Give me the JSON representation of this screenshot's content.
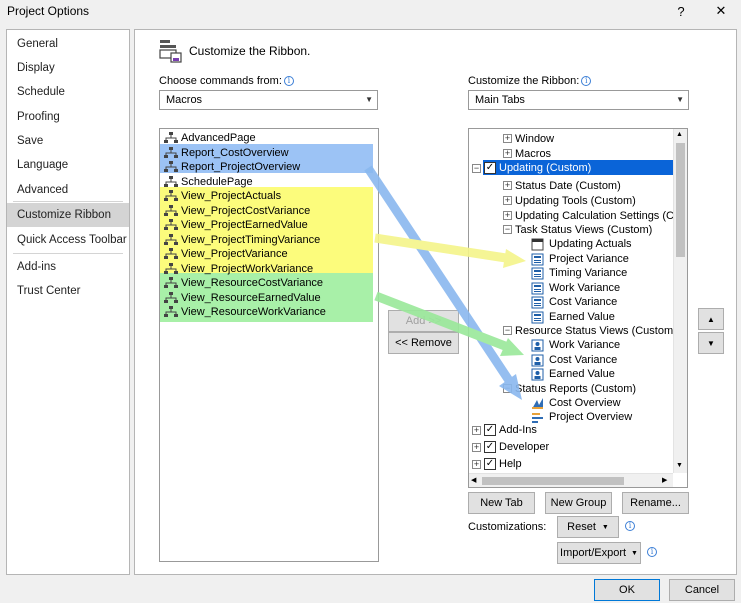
{
  "window": {
    "title": "Project Options",
    "help_label": "?",
    "close_label": "✕"
  },
  "nav": {
    "items": [
      "General",
      "Display",
      "Schedule",
      "Proofing",
      "Save",
      "Language",
      "Advanced",
      "Customize Ribbon",
      "Quick Access Toolbar",
      "Add-ins",
      "Trust Center"
    ],
    "selected": "Customize Ribbon"
  },
  "header": {
    "title": "Customize the Ribbon."
  },
  "left": {
    "label": "Choose commands from:",
    "combo_value": "Macros",
    "commands": [
      "AdvancedPage",
      "Report_CostOverview",
      "Report_ProjectOverview",
      "SchedulePage",
      "View_ProjectActuals",
      "View_ProjectCostVariance",
      "View_ProjectEarnedValue",
      "View_ProjectTimingVariance",
      "View_ProjectVariance",
      "View_ProjectWorkVariance",
      "View_ResourceCostVariance",
      "View_ResourceEarnedValue",
      "View_ResourceWorkVariance"
    ]
  },
  "middle": {
    "add_label": "Add >>",
    "remove_label": "<< Remove"
  },
  "right": {
    "label": "Customize the Ribbon:",
    "combo_value": "Main Tabs",
    "tree": {
      "window": "Window",
      "macros": "Macros",
      "updating": "Updating (Custom)",
      "status_date": "Status Date (Custom)",
      "updating_tools": "Updating Tools (Custom)",
      "updating_calc": "Updating Calculation Settings (Cu",
      "task_status": "Task Status Views (Custom)",
      "task_items": [
        "Updating Actuals",
        "Project Variance",
        "Timing Variance",
        "Work Variance",
        "Cost Variance",
        "Earned Value"
      ],
      "resource_status": "Resource Status Views (Custom)",
      "resource_items": [
        "Work Variance",
        "Cost Variance",
        "Earned Value"
      ],
      "status_reports": "Status Reports (Custom)",
      "report_items": [
        "Cost Overview",
        "Project Overview"
      ],
      "addins": "Add-Ins",
      "developer": "Developer",
      "help": "Help"
    },
    "new_tab": "New Tab",
    "new_group": "New Group",
    "rename": "Rename...",
    "customizations_label": "Customizations:",
    "reset_label": "Reset",
    "import_export_label": "Import/Export",
    "move_up": "▲",
    "move_down": "▼"
  },
  "footer": {
    "ok_label": "OK",
    "cancel_label": "Cancel"
  },
  "colors": {
    "highlight_blue": "#9cc3f5",
    "highlight_yellow": "#fcfc7c",
    "highlight_green": "#a8f0a8",
    "selection": "#0a64d8",
    "arrow_blue": "#8ab8ef",
    "arrow_yellow": "#f4f48a",
    "arrow_green": "#9ae89a"
  }
}
